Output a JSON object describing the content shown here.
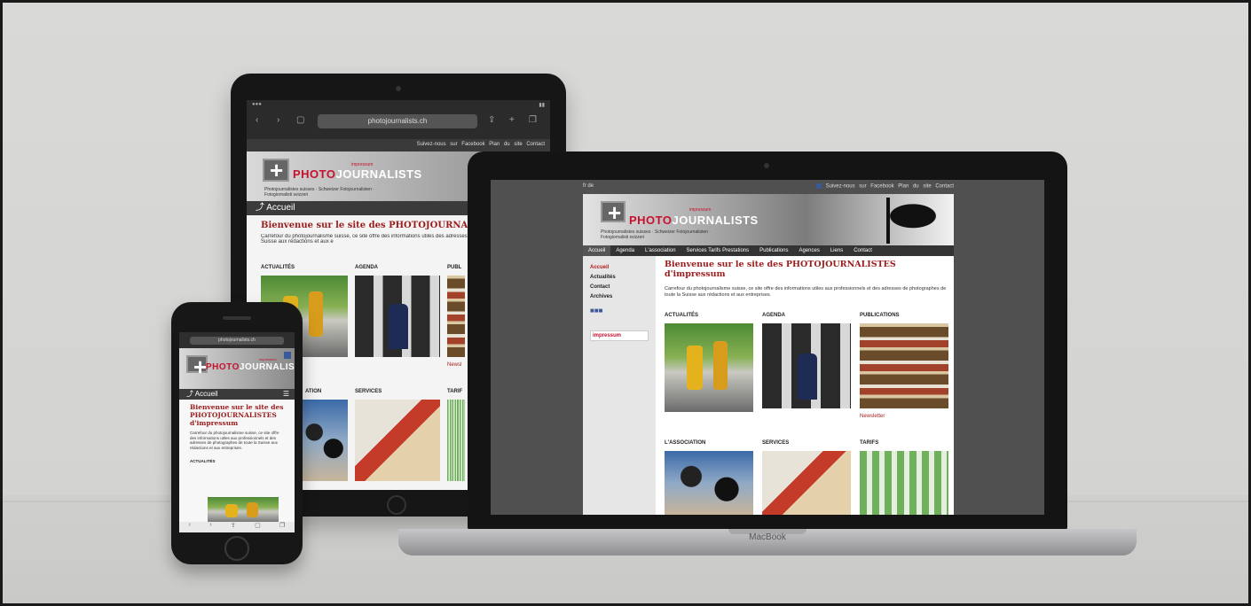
{
  "colors": {
    "brand_red": "#c8102e",
    "headline_red": "#9b1c1c",
    "nav_dark": "#333333"
  },
  "tablet": {
    "url": "photojournalists.ch",
    "topbar": "Suivez-nous sur Facebook   Plan du site   Contact",
    "logo_photo": "PHOTO",
    "logo_journalists": "JOURNALISTS",
    "logo_impressum": "impressum",
    "tagline": "Photojournalistes suisses · Schweizer Fotojournalisten · Fotogiornalisti svizzeri",
    "nav_label": "Accueil",
    "welcome": "Bienvenue sur le site des PHOTOJOURNALISTES",
    "intro": "Carrefour du photojournalisme suisse, ce site offre des informations utiles des adresses de photographes de toute la Suisse aux rédactions et aux e",
    "sections": [
      "ACTUALITÉS",
      "AGENDA",
      "PUBL"
    ],
    "sections_row2": [
      "ATION",
      "SERVICES",
      "TARIF"
    ],
    "newsletter": "Newsl"
  },
  "laptop": {
    "brand": "MacBook",
    "lang": "fr  de",
    "topbar": "Suivez-nous sur Facebook   Plan du site   Contact",
    "logo_photo": "PHOTO",
    "logo_journalists": "JOURNALISTS",
    "logo_impressum": "impressum",
    "tagline": "Photojournalistes suisses · Schweizer Fotojournalisten · Fotogiornalisti svizzeri",
    "nav": [
      "Accueil",
      "Agenda",
      "L'association",
      "Services Tarifs Prestations",
      "Publications",
      "Agences",
      "Liens",
      "Contact"
    ],
    "side": [
      "Accueil",
      "Actualités",
      "Contact",
      "Archives"
    ],
    "side_logo": "impressum",
    "welcome": "Bienvenue sur le site des PHOTOJOURNALISTES d'impressum",
    "intro": "Carrefour du photojournalisme suisse, ce site offre des informations utiles aux professionnels et des adresses de photographes de toute la Suisse aux rédactions et aux entreprises.",
    "sections": [
      "ACTUALITÉS",
      "AGENDA",
      "PUBLICATIONS"
    ],
    "sections_row2": [
      "L'ASSOCIATION",
      "SERVICES",
      "TARIFS"
    ],
    "newsletter": "Newsletter"
  },
  "phone": {
    "url": "photojournalists.ch",
    "logo_photo": "PHOTO",
    "logo_journalists": "JOURNALISTS",
    "logo_impressum": "impressum",
    "nav_label": "Accueil",
    "welcome": "Bienvenue sur le site des PHOTOJOURNALISTES d'impressum",
    "intro": "Carrefour du photojournalisme suisse, ce site offre des informations utiles aux professionnels et des adresses de photographes de toute la Suisse aux rédactions et aux entreprises.",
    "section": "ACTUALITÉS"
  }
}
